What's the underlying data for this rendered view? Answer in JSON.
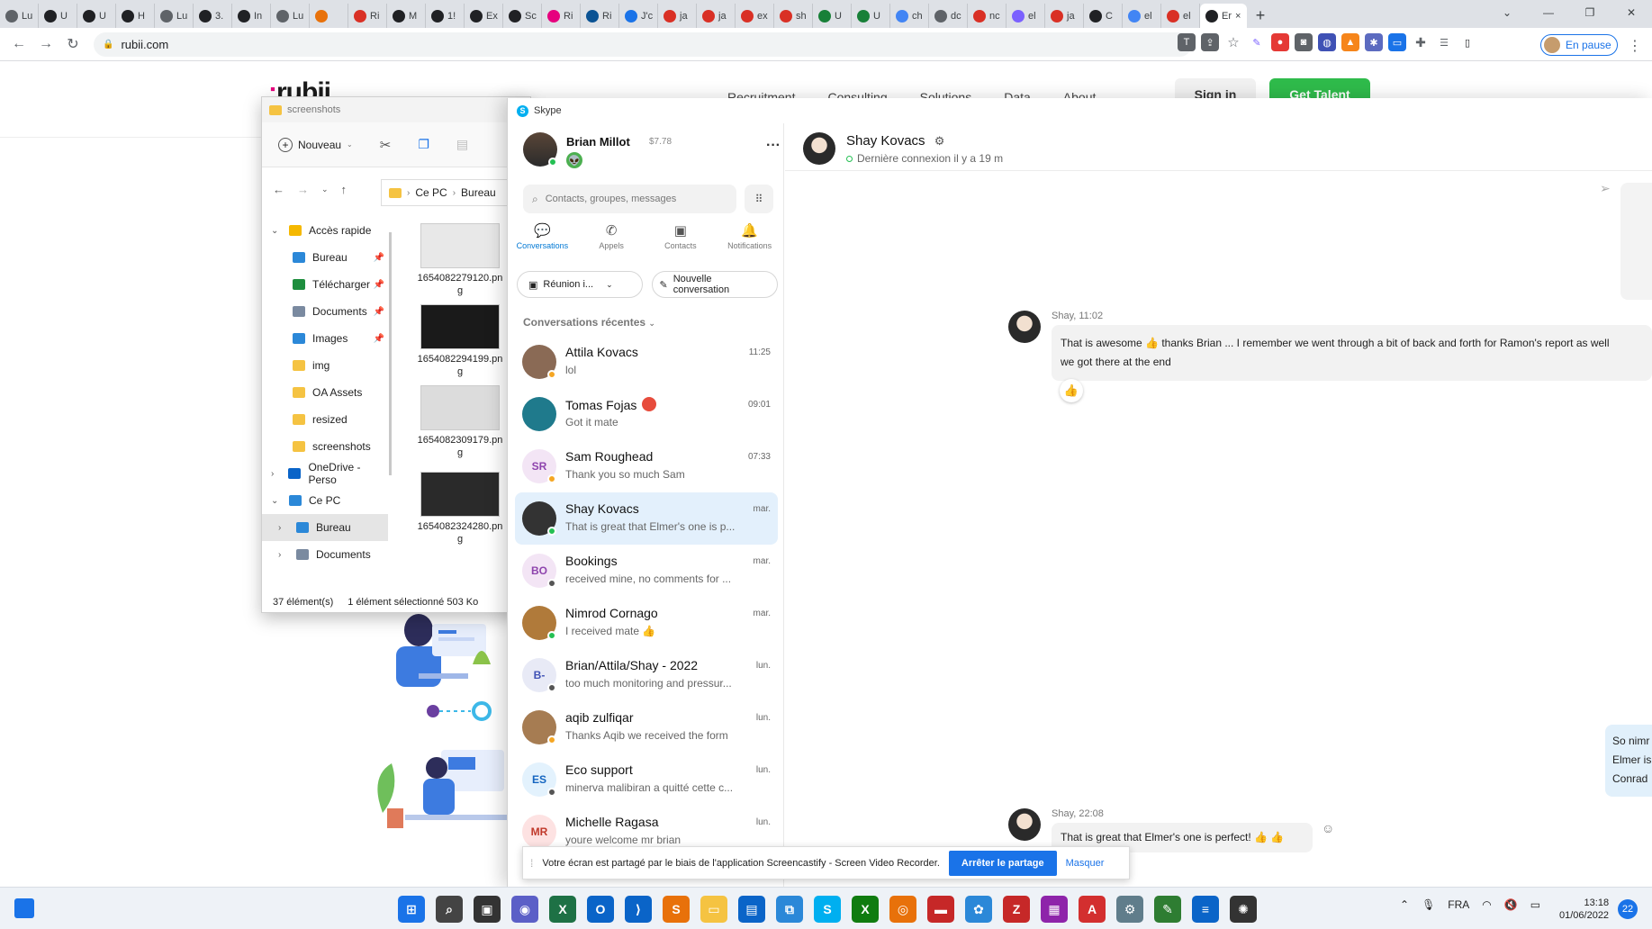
{
  "browser": {
    "tabs": [
      {
        "label": "Lu",
        "color": "#5f6368"
      },
      {
        "label": "U",
        "color": "#202124"
      },
      {
        "label": "U",
        "color": "#202124"
      },
      {
        "label": "H",
        "color": "#202124"
      },
      {
        "label": "Lu",
        "color": "#5f6368"
      },
      {
        "label": "3.",
        "color": "#202124"
      },
      {
        "label": "In",
        "color": "#202124"
      },
      {
        "label": "Lu",
        "color": "#5f6368"
      },
      {
        "label": "",
        "color": "#e8710a"
      },
      {
        "label": "Ri",
        "color": "#d93025"
      },
      {
        "label": "M",
        "color": "#202124"
      },
      {
        "label": "1!",
        "color": "#202124"
      },
      {
        "label": "Ex",
        "color": "#202124"
      },
      {
        "label": "Sc",
        "color": "#202124"
      },
      {
        "label": "Ri",
        "color": "#e6007e"
      },
      {
        "label": "Ri",
        "color": "#0b5394"
      },
      {
        "label": "J'c",
        "color": "#1a73e8"
      },
      {
        "label": "ja",
        "color": "#d93025"
      },
      {
        "label": "ja",
        "color": "#d93025"
      },
      {
        "label": "ex",
        "color": "#d93025"
      },
      {
        "label": "sh",
        "color": "#d93025"
      },
      {
        "label": "U",
        "color": "#188038"
      },
      {
        "label": "U",
        "color": "#188038"
      },
      {
        "label": "ch",
        "color": "#4285f4"
      },
      {
        "label": "dc",
        "color": "#5f6368"
      },
      {
        "label": "nc",
        "color": "#d93025"
      },
      {
        "label": "el",
        "color": "#7b61ff"
      },
      {
        "label": "ja",
        "color": "#d93025"
      },
      {
        "label": "C",
        "color": "#202124"
      },
      {
        "label": "el",
        "color": "#4285f4"
      },
      {
        "label": "el",
        "color": "#d93025"
      },
      {
        "label": "Er",
        "color": "#202124"
      }
    ],
    "active_tab_close": "×",
    "new_tab": "+",
    "url": "rubii.com",
    "profile_label": "En pause"
  },
  "page": {
    "logo": "rubii",
    "nav": [
      "Recruitment",
      "Consulting",
      "Solutions",
      "Data",
      "About"
    ],
    "sign_in": "Sign in",
    "get_talent": "Get Talent"
  },
  "explorer": {
    "title": "screenshots",
    "new_label": "Nouveau",
    "path": [
      "Ce PC",
      "Bureau"
    ],
    "nav_items": [
      {
        "label": "Accès rapide",
        "group": true,
        "icon": "star-icon",
        "color": "#f5b800"
      },
      {
        "label": "Bureau",
        "pinned": true,
        "icon": "desktop-icon",
        "color": "#2b88d8"
      },
      {
        "label": "Télécharger",
        "pinned": true,
        "icon": "download-icon",
        "color": "#1e8e3e"
      },
      {
        "label": "Documents",
        "pinned": true,
        "icon": "document-icon",
        "color": "#7a8aa0"
      },
      {
        "label": "Images",
        "pinned": true,
        "icon": "images-icon",
        "color": "#2b88d8"
      },
      {
        "label": "img",
        "icon": "folder-icon",
        "color": "#f5c342"
      },
      {
        "label": "OA Assets",
        "icon": "folder-icon",
        "color": "#f5c342"
      },
      {
        "label": "resized",
        "icon": "folder-icon",
        "color": "#f5c342"
      },
      {
        "label": "screenshots",
        "icon": "folder-icon",
        "color": "#f5c342"
      },
      {
        "label": "OneDrive - Perso",
        "group": true,
        "icon": "cloud-icon",
        "color": "#0a64c8"
      },
      {
        "label": "Ce PC",
        "group": true,
        "icon": "pc-icon",
        "color": "#2b88d8"
      },
      {
        "label": "Bureau",
        "icon": "desktop-icon",
        "color": "#2b88d8",
        "selected": true
      },
      {
        "label": "Documents",
        "icon": "document-icon",
        "color": "#7a8aa0"
      }
    ],
    "files": [
      {
        "name": "1654082279120.png",
        "thumb": "#e8e8e8"
      },
      {
        "name": "1654082294199.png",
        "thumb": "#1a1a1a"
      },
      {
        "name": "1654082309179.png",
        "thumb": "#dcdcdc"
      },
      {
        "name": "1654082324280.png",
        "thumb": "#2a2a2a"
      }
    ],
    "status_count": "37 élément(s)",
    "status_selected": "1 élément sélectionné  503 Ko"
  },
  "skype": {
    "title": "Skype",
    "me": {
      "name": "Brian Millot",
      "credit": "$7.78"
    },
    "search_placeholder": "Contacts, groupes, messages",
    "tabs": [
      {
        "label": "Conversations",
        "icon": "chat-icon",
        "active": true
      },
      {
        "label": "Appels",
        "icon": "phone-icon"
      },
      {
        "label": "Contacts",
        "icon": "contacts-icon"
      },
      {
        "label": "Notifications",
        "icon": "bell-icon"
      }
    ],
    "meet_label": "Réunion i...",
    "new_conv_label": "Nouvelle conversation",
    "recent_label": "Conversations récentes",
    "conversations": [
      {
        "name": "Attila Kovacs",
        "msg": "lol",
        "time": "11:25",
        "initials": "",
        "avatar": "#8a6a55",
        "status": "#f5a623"
      },
      {
        "name": "Tomas Fojas",
        "msg": "Got it mate",
        "time": "09:01",
        "initials": "",
        "avatar": "#1f7a8c",
        "status": "",
        "badge": true
      },
      {
        "name": "Sam Roughead",
        "msg": "Thank you so much Sam",
        "time": "07:33",
        "initials": "SR",
        "avatar": "#f3e5f5",
        "initials_color": "#8e44ad",
        "status": "#f5a623"
      },
      {
        "name": "Shay Kovacs",
        "msg": "That is great that Elmer's one is p...",
        "time": "mar.",
        "initials": "",
        "avatar": "#333333",
        "status": "#24c053",
        "selected": true
      },
      {
        "name": "Bookings",
        "msg": "received mine, no comments for ...",
        "time": "mar.",
        "initials": "BO",
        "avatar": "#f3e5f5",
        "initials_color": "#8e44ad",
        "status": "#555555"
      },
      {
        "name": "Nimrod Cornago",
        "msg": "I received mate 👍",
        "time": "mar.",
        "initials": "",
        "avatar": "#b07a3a",
        "status": "#24c053"
      },
      {
        "name": "Brian/Attila/Shay - 2022",
        "msg": "too much monitoring and pressur...",
        "time": "lun.",
        "initials": "B-",
        "avatar": "#e8eaf6",
        "initials_color": "#3f51b5",
        "status": "#555555"
      },
      {
        "name": "aqib zulfiqar",
        "msg": "Thanks Aqib we received the form",
        "time": "lun.",
        "initials": "",
        "avatar": "#a67c52",
        "status": "#f5a623"
      },
      {
        "name": "Eco support",
        "msg": "minerva malibiran a quitté cette c...",
        "time": "lun.",
        "initials": "ES",
        "avatar": "#e3f2fd",
        "initials_color": "#1565c0",
        "status": "#555555"
      },
      {
        "name": "Michelle Ragasa",
        "msg": "youre welcome mr brian",
        "time": "lun.",
        "initials": "MR",
        "avatar": "#fde2e2",
        "initials_color": "#c0392b",
        "status": ""
      }
    ],
    "chat": {
      "name": "Shay Kovacs",
      "last_seen": "Dernière connexion il y a 19 m",
      "messages": [
        {
          "meta": "Shay, 11:02",
          "text1": "That is awesome 👍  thanks Brian ... I remember we went through a bit of back and forth for Ramon's report as well",
          "text2": "we got there at the end",
          "reaction": "👍"
        },
        {
          "meta": "Shay, 22:08",
          "text1": "That is great that Elmer's one is perfect! 👍 👍"
        }
      ],
      "right_bubble": [
        "So nimr",
        "Elmer is",
        "Conrad"
      ]
    }
  },
  "share_bar": {
    "text": "Votre écran est partagé par le biais de l'application Screencastify - Screen Video Recorder.",
    "stop": "Arrêter le partage",
    "hide": "Masquer"
  },
  "taskbar": {
    "apps": [
      {
        "name": "windows-start-icon",
        "color": "#1a73e8",
        "glyph": "⊞"
      },
      {
        "name": "search-icon",
        "color": "#444444",
        "glyph": "⌕"
      },
      {
        "name": "task-view-icon",
        "color": "#333333",
        "glyph": "▣"
      },
      {
        "name": "teams-chat-icon",
        "color": "#5b5fc7",
        "glyph": "◉"
      },
      {
        "name": "excel-icon",
        "color": "#1e7145",
        "glyph": "X"
      },
      {
        "name": "outlook-icon",
        "color": "#0a64c8",
        "glyph": "O"
      },
      {
        "name": "vscode-icon",
        "color": "#0a64c8",
        "glyph": "⟩"
      },
      {
        "name": "sublime-icon",
        "color": "#e8710a",
        "glyph": "S"
      },
      {
        "name": "explorer-icon",
        "color": "#f5c342",
        "glyph": "▭"
      },
      {
        "name": "store-icon",
        "color": "#0a64c8",
        "glyph": "▤"
      },
      {
        "name": "network-icon",
        "color": "#2b88d8",
        "glyph": "⧉"
      },
      {
        "name": "skype-icon",
        "color": "#00aff0",
        "glyph": "S"
      },
      {
        "name": "xbox-icon",
        "color": "#107c10",
        "glyph": "X"
      },
      {
        "name": "chrome-icon",
        "color": "#e8710a",
        "glyph": "◎"
      },
      {
        "name": "terminal-icon",
        "color": "#c62828",
        "glyph": "▬"
      },
      {
        "name": "settings-app-icon",
        "color": "#2b88d8",
        "glyph": "✿"
      },
      {
        "name": "filezilla-icon",
        "color": "#c62828",
        "glyph": "Z"
      },
      {
        "name": "winrar-icon",
        "color": "#8e24aa",
        "glyph": "▦"
      },
      {
        "name": "acrobat-icon",
        "color": "#d32f2f",
        "glyph": "A"
      },
      {
        "name": "gear-icon",
        "color": "#607d8b",
        "glyph": "⚙"
      },
      {
        "name": "notepad-icon",
        "color": "#2e7d32",
        "glyph": "✎"
      },
      {
        "name": "notes-icon",
        "color": "#0a64c8",
        "glyph": "≡"
      },
      {
        "name": "openai-icon",
        "color": "#333333",
        "glyph": "✺"
      }
    ],
    "lang": "FRA",
    "time": "13:18",
    "date": "01/06/2022",
    "notifications": "22"
  }
}
